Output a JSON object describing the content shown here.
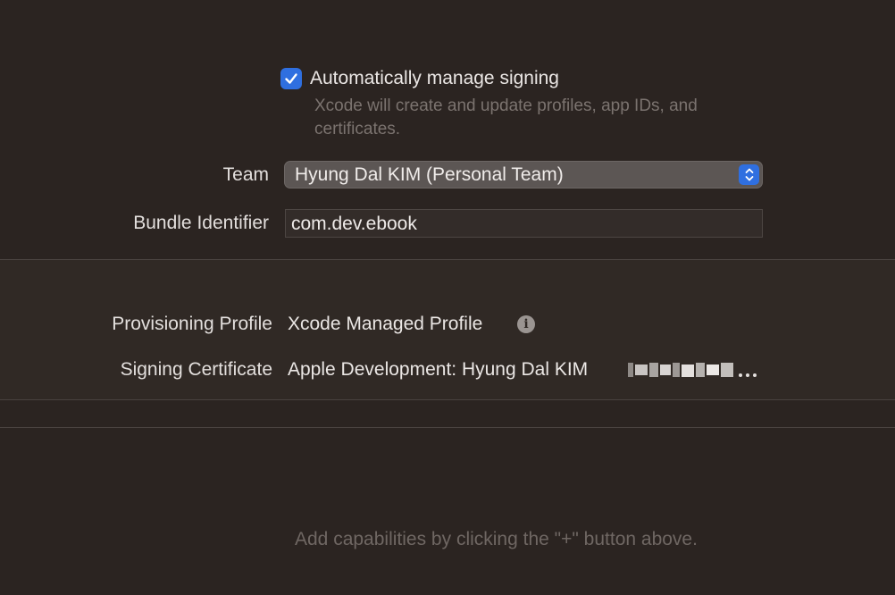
{
  "signing": {
    "auto_manage_label": "Automatically manage signing",
    "auto_manage_checked": true,
    "auto_manage_description": "Xcode will create and update profiles, app IDs, and certificates.",
    "team_label": "Team",
    "team_value": "Hyung Dal KIM (Personal Team)",
    "bundle_label": "Bundle Identifier",
    "bundle_value": "com.dev.ebook",
    "provisioning_label": "Provisioning Profile",
    "provisioning_value": "Xcode Managed Profile",
    "certificate_label": "Signing Certificate",
    "certificate_value": "Apple Development: Hyung Dal KIM"
  },
  "capabilities": {
    "hint": "Add capabilities by clicking the \"+\" button above."
  },
  "icons": {
    "checkbox": "checkmark-icon",
    "select": "chevron-up-down-icon",
    "info": "info-icon"
  },
  "colors": {
    "accent": "#2f6fe0",
    "background": "#2b2421",
    "section": "#302925"
  }
}
